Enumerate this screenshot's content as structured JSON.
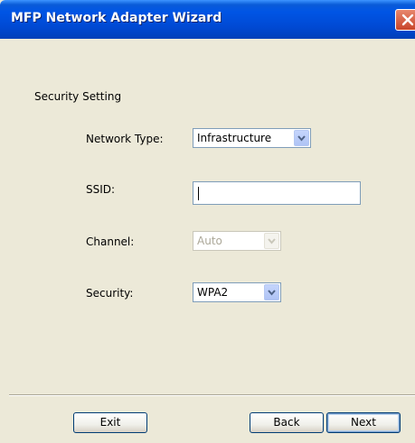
{
  "window": {
    "title": "MFP Network Adapter Wizard"
  },
  "section": {
    "heading": "Security Setting"
  },
  "fields": {
    "network_type": {
      "label": "Network Type:",
      "value": "Infrastructure"
    },
    "ssid": {
      "label": "SSID:",
      "value": ""
    },
    "channel": {
      "label": "Channel:",
      "value": "Auto",
      "enabled": false
    },
    "security": {
      "label": "Security:",
      "value": "WPA2"
    }
  },
  "buttons": {
    "exit": "Exit",
    "back": "Back",
    "next": "Next"
  },
  "colors": {
    "titlebar": "#0055E5",
    "dialog_bg": "#ECE9D8",
    "close_button": "#D9583B"
  }
}
